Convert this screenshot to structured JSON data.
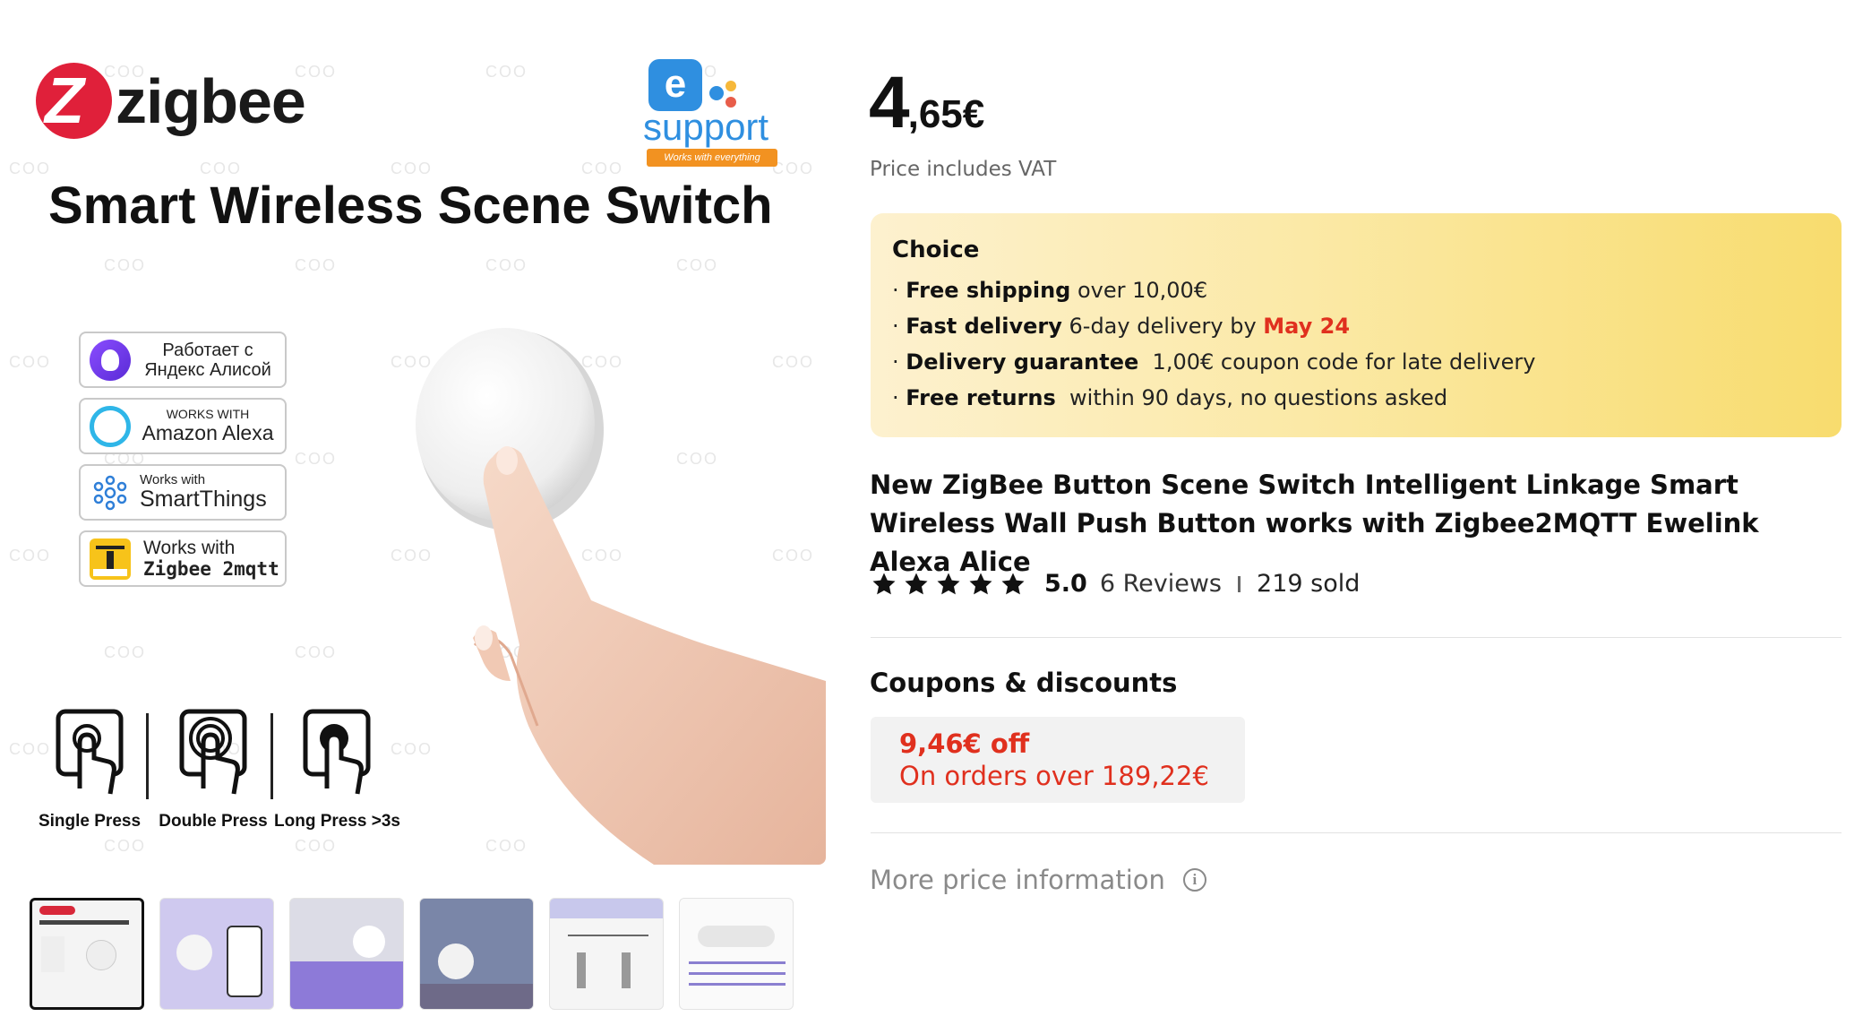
{
  "gallery": {
    "main_image": {
      "brand": "zigbee",
      "brand_mark": "Z",
      "partner_logo": {
        "letter": "e",
        "word": "support",
        "tagline": "Works with everything"
      },
      "headline": "Smart Wireless Scene Switch",
      "watermark": "COO",
      "badges": [
        {
          "icon": "alice-icon",
          "line1": "Работает с",
          "line2": "Яндекс Алисой"
        },
        {
          "icon": "alexa-icon",
          "line1": "WORKS WITH",
          "line2": "Amazon Alexa"
        },
        {
          "icon": "smartthings-icon",
          "line1": "Works with",
          "line2": "SmartThings"
        },
        {
          "icon": "zigbee2mqtt-icon",
          "line1": "Works with",
          "line2": "Zigbee 2mqtt"
        }
      ],
      "press_modes": [
        "Single Press",
        "Double Press",
        "Long Press >3s"
      ]
    },
    "thumbnails_count": 6
  },
  "price": {
    "integer": "4",
    "decimal": ",65€",
    "vat_note": "Price includes VAT"
  },
  "choice": {
    "title": "Choice",
    "lines": [
      {
        "bold": "Free shipping",
        "text": " over 10,00€"
      },
      {
        "bold": "Fast delivery",
        "text": " 6-day delivery by ",
        "highlight": "May 24"
      },
      {
        "bold": "Delivery guarantee",
        "text": "  1,00€ coupon code for late delivery"
      },
      {
        "bold": "Free returns",
        "text": "  within 90 days, no questions asked"
      }
    ],
    "bullet": "·",
    "highlight_color": "#e0301e"
  },
  "product": {
    "title": "New ZigBee Button Scene Switch Intelligent Linkage Smart Wireless Wall Push Button works with Zigbee2MQTT Ewelink Alexa Alice",
    "rating": "5.0",
    "stars": 5,
    "reviews": "6 Reviews",
    "sold": "219 sold"
  },
  "coupons": {
    "title": "Coupons & discounts",
    "items": [
      {
        "off": "9,46€ off",
        "condition": "On orders over 189,22€"
      }
    ]
  },
  "more_price": {
    "label": "More price information",
    "icon": "info-icon",
    "icon_glyph": "i"
  }
}
